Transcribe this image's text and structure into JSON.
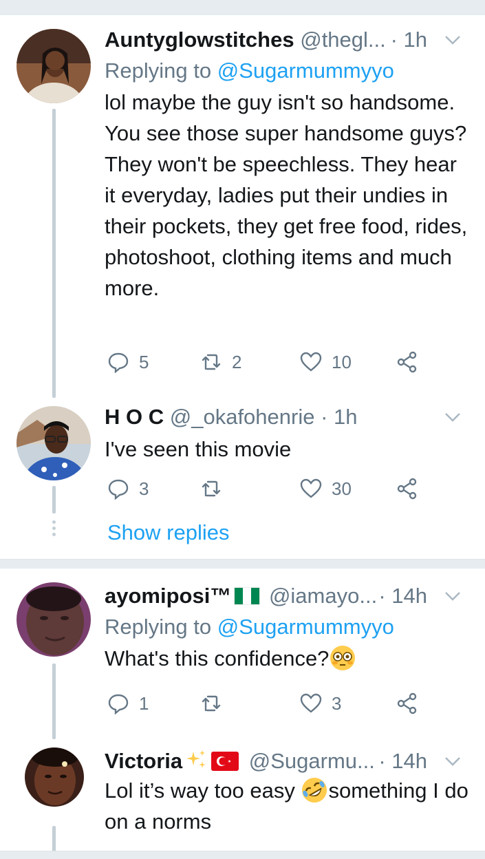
{
  "tweets": [
    {
      "name": "Auntyglowstitches",
      "handle": "@thegl...",
      "time": "· 1h",
      "replying_prefix": "Replying to ",
      "replying_to": "@Sugarmummyyo",
      "text": "lol maybe the guy isn't so handsome. You see those super handsome guys? They won't be speechless. They hear it everyday, ladies put their undies in their pockets,  they get free food, rides, photoshoot, clothing items and much more.",
      "replies": "5",
      "retweets": "2",
      "likes": "10"
    },
    {
      "name": "H O C",
      "handle": "@_okafohenrie",
      "time": "· 1h",
      "text": "I've seen this movie",
      "replies": "3",
      "retweets": "",
      "likes": "30"
    },
    {
      "name": "ayomiposi™",
      "handle": "@iamayo...",
      "time": "· 14h",
      "replying_prefix": "Replying to ",
      "replying_to": "@Sugarmummyyo",
      "text": "What's this confidence?",
      "replies": "1",
      "retweets": "",
      "likes": "3"
    },
    {
      "name": "Victoria",
      "handle": "@Sugarmu...",
      "time": "· 14h",
      "text_before_emoji": "Lol it’s way too easy ",
      "text_after_emoji": "something I do on a norms"
    }
  ],
  "show_replies": "Show replies",
  "icons": {
    "reply": "reply-icon",
    "retweet": "retweet-icon",
    "like": "heart-icon",
    "share": "share-icon",
    "menu": "chevron-down-icon"
  },
  "colors": {
    "link": "#1da1f2",
    "secondary": "#657786",
    "separator": "#e6ecf0",
    "thread": "#c4cfd6"
  }
}
